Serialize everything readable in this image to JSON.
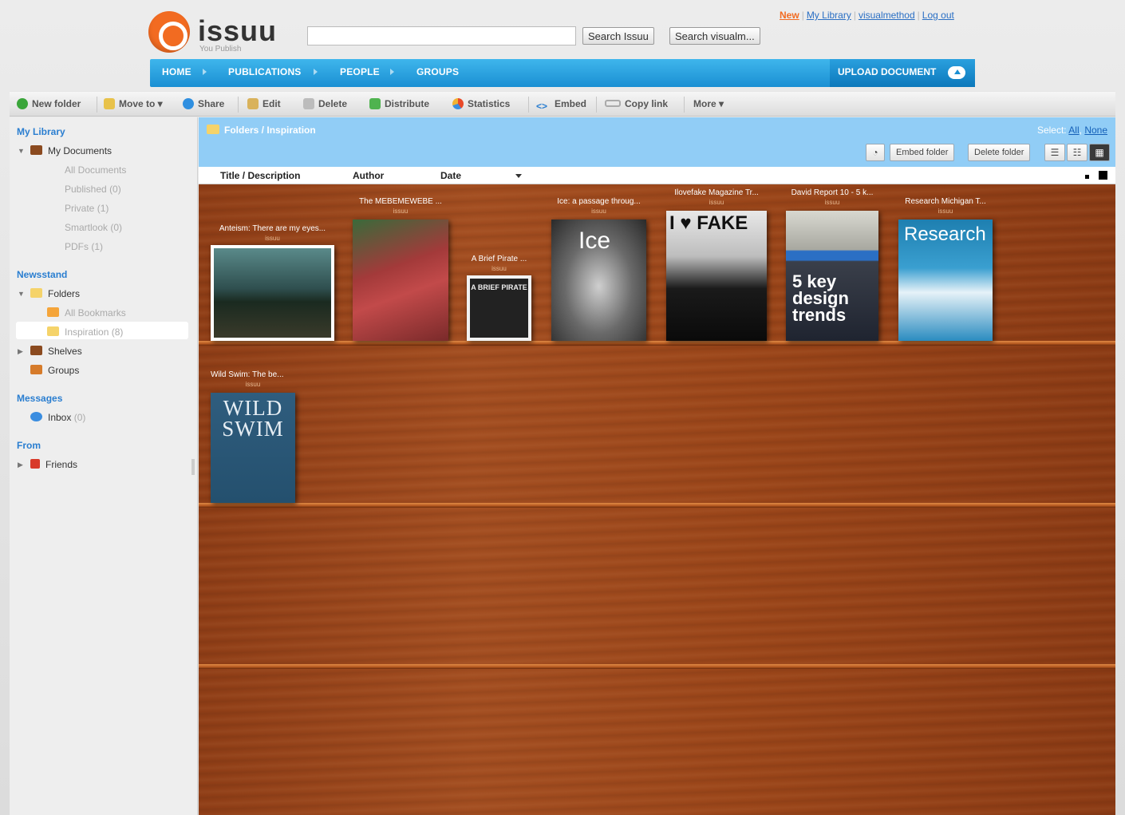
{
  "brand": {
    "name": "issuu",
    "tagline": "You Publish"
  },
  "search": {
    "placeholder": "",
    "btn_issuu": "Search Issuu",
    "btn_user": "Search visualm..."
  },
  "toplinks": {
    "new": "New",
    "library": "My Library",
    "user": "visualmethod",
    "logout": "Log out"
  },
  "nav": {
    "home": "HOME",
    "publications": "PUBLICATIONS",
    "people": "PEOPLE",
    "groups": "GROUPS",
    "upload": "UPLOAD DOCUMENT"
  },
  "toolbar": {
    "new_folder": "New folder",
    "move_to": "Move to ▾",
    "share": "Share",
    "edit": "Edit",
    "delete": "Delete",
    "distribute": "Distribute",
    "statistics": "Statistics",
    "embed": "Embed",
    "copy_link": "Copy link",
    "more": "More ▾"
  },
  "sidebar": {
    "my_library": "My Library",
    "my_documents": "My Documents",
    "all_documents": "All Documents",
    "published": "Published",
    "published_count": "(0)",
    "private": "Private",
    "private_count": "(1)",
    "smartlook": "Smartlook",
    "smartlook_count": "(0)",
    "pdfs": "PDFs",
    "pdfs_count": "(1)",
    "newsstand": "Newsstand",
    "folders": "Folders",
    "all_bookmarks": "All Bookmarks",
    "inspiration": "Inspiration",
    "inspiration_count": "(8)",
    "shelves": "Shelves",
    "groups": "Groups",
    "messages": "Messages",
    "inbox": "Inbox",
    "inbox_count": "(0)",
    "from": "From",
    "friends": "Friends"
  },
  "folder": {
    "crumb_root": "Folders",
    "crumb_sep": " / ",
    "crumb_current": "Inspiration",
    "select_label": "Select:",
    "select_all": "All",
    "select_none": "None",
    "embed_folder": "Embed folder",
    "delete_folder": "Delete folder"
  },
  "columns": {
    "title": "Title / Description",
    "author": "Author",
    "date": "Date"
  },
  "publications": [
    {
      "title": "Anteism: There are my eyes...",
      "user": "issuu",
      "cover_text": ""
    },
    {
      "title": "The MEBEMEWEBE ...",
      "user": "issuu",
      "cover_text": ""
    },
    {
      "title": "A Brief Pirate ...",
      "user": "issuu",
      "cover_text": "A BRIEF PIRATE"
    },
    {
      "title": "Ice: a passage throug...",
      "user": "issuu",
      "cover_text": "Ice"
    },
    {
      "title": "Ilovefake Magazine Tr...",
      "user": "issuu",
      "cover_text": "I ♥ FAKE"
    },
    {
      "title": "David Report 10 - 5 k...",
      "user": "issuu",
      "cover_text": "5 key design trends"
    },
    {
      "title": "Research Michigan T...",
      "user": "issuu",
      "cover_text": "Research"
    },
    {
      "title": "Wild Swim: The be...",
      "user": "issuu",
      "cover_text": "WILD SWIM"
    }
  ],
  "colors": {
    "accent": "#f26b21",
    "nav": "#1a8fd3",
    "folderbar": "#91cdf6",
    "wood": "#9a4519"
  }
}
